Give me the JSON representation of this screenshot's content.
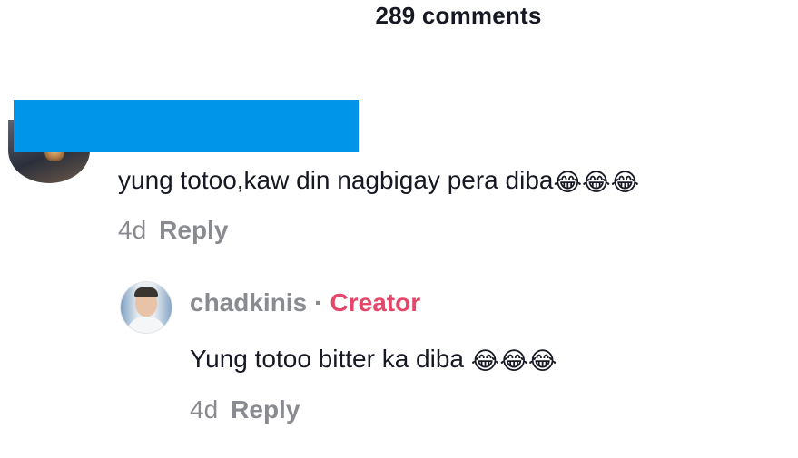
{
  "header": {
    "comment_count": "289 comments"
  },
  "comments": [
    {
      "text": "yung totoo,kaw din nagbigay pera diba",
      "emojis": [
        "😂",
        "😂",
        "😂"
      ],
      "time": "4d",
      "reply_label": "Reply"
    }
  ],
  "replies": [
    {
      "username": "chadkinis",
      "separator": "·",
      "badge": "Creator",
      "text": "Yung totoo bitter ka diba ",
      "emojis": [
        "😂",
        "😂",
        "😂"
      ],
      "time": "4d",
      "reply_label": "Reply"
    }
  ],
  "colors": {
    "redaction": "#0095e8",
    "creator_badge": "#e5476b",
    "secondary_text": "#8a8b91",
    "primary_text": "#161823"
  }
}
